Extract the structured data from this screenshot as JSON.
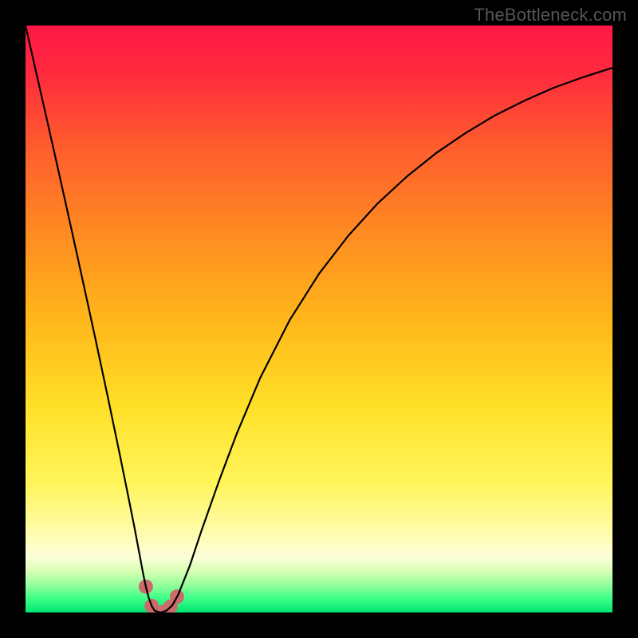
{
  "watermark": "TheBottleneck.com",
  "chart_data": {
    "type": "line",
    "title": "",
    "xlabel": "",
    "ylabel": "",
    "xlim": [
      0,
      1
    ],
    "ylim": [
      0,
      1
    ],
    "legend": false,
    "grid": false,
    "background": {
      "type": "vertical-gradient",
      "stops": [
        {
          "offset": 0.0,
          "color": "#ff1846"
        },
        {
          "offset": 0.08,
          "color": "#ff2a3e"
        },
        {
          "offset": 0.2,
          "color": "#ff5a2e"
        },
        {
          "offset": 0.35,
          "color": "#ff8a22"
        },
        {
          "offset": 0.5,
          "color": "#ffb61a"
        },
        {
          "offset": 0.65,
          "color": "#ffe028"
        },
        {
          "offset": 0.78,
          "color": "#fff55a"
        },
        {
          "offset": 0.86,
          "color": "#fffca8"
        },
        {
          "offset": 0.905,
          "color": "#fcffd8"
        },
        {
          "offset": 0.93,
          "color": "#d6ffb4"
        },
        {
          "offset": 0.955,
          "color": "#8eff9a"
        },
        {
          "offset": 0.975,
          "color": "#3fff88"
        },
        {
          "offset": 1.0,
          "color": "#00e673"
        }
      ]
    },
    "series": [
      {
        "name": "bottleneck-curve",
        "color": "#000000",
        "width": 2.2,
        "x": [
          0.0,
          0.02,
          0.04,
          0.06,
          0.08,
          0.1,
          0.12,
          0.14,
          0.16,
          0.175,
          0.185,
          0.195,
          0.2,
          0.205,
          0.21,
          0.215,
          0.22,
          0.23,
          0.24,
          0.25,
          0.26,
          0.28,
          0.3,
          0.33,
          0.36,
          0.4,
          0.45,
          0.5,
          0.55,
          0.6,
          0.65,
          0.7,
          0.75,
          0.8,
          0.85,
          0.9,
          0.95,
          1.0
        ],
        "y": [
          1.0,
          0.912,
          0.824,
          0.735,
          0.645,
          0.554,
          0.462,
          0.368,
          0.272,
          0.198,
          0.148,
          0.095,
          0.068,
          0.044,
          0.025,
          0.011,
          0.003,
          0.0,
          0.003,
          0.012,
          0.03,
          0.08,
          0.14,
          0.225,
          0.305,
          0.4,
          0.498,
          0.577,
          0.642,
          0.697,
          0.743,
          0.783,
          0.817,
          0.847,
          0.872,
          0.894,
          0.912,
          0.928
        ]
      }
    ],
    "markers": [
      {
        "name": "highlight-dip",
        "color": "#cc6b6b",
        "radius_px": 9,
        "points": [
          {
            "x": 0.205,
            "y": 0.044
          },
          {
            "x": 0.215,
            "y": 0.011
          },
          {
            "x": 0.223,
            "y": 0.0
          },
          {
            "x": 0.235,
            "y": 0.001
          },
          {
            "x": 0.247,
            "y": 0.01
          },
          {
            "x": 0.258,
            "y": 0.027
          }
        ]
      }
    ]
  }
}
